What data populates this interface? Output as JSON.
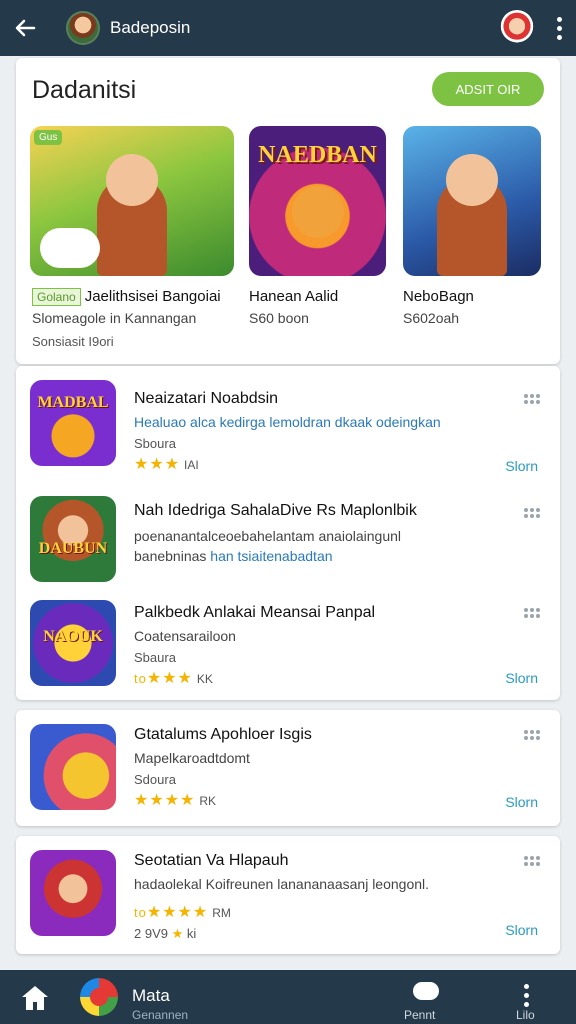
{
  "topbar": {
    "title": "Badeposin"
  },
  "featured": {
    "title": "Dadanitsi",
    "action_label": "ADSIT OIR",
    "items": [
      {
        "badge": "Golano",
        "tag": "Gus",
        "name": "Jaelithsisei Bangoiai",
        "sub": "Slomeagole in Kannangan",
        "extra": "Sonsiasit I9ori"
      },
      {
        "logo": "NAEDBAN",
        "name": "Hanean Aalid",
        "sub": "S60 boon"
      },
      {
        "name": "NeboBagn",
        "sub": "S602oah"
      }
    ]
  },
  "list": [
    {
      "icon_text": "MADBAL",
      "name": "Neaizatari Noabdsin",
      "desc": "Healuao alca kedirga lemoldran dkaak odeingkan",
      "meta": "Sboura",
      "stars": "★★★",
      "count": "IAI",
      "action": "Slorn"
    },
    {
      "icon_text": "DAUBUN",
      "name": "Nah Idedriga SahalaDive Rs Maplonlbik",
      "desc": "poenanantalceoebahelantam anaiolaingunl",
      "desc2_a": "banebninas",
      "desc2_b": "han tsiaitenabadtan",
      "action": ""
    },
    {
      "icon_text": "NAOUK",
      "name": "Palkbedk Anlakai Meansai Panpal",
      "desc": "Coatensarailoon",
      "meta": "Sbaura",
      "stars": "★★★",
      "star_prefix": "to",
      "count": "KK",
      "action": "Slorn"
    }
  ],
  "single_cards": [
    {
      "name": "Gtatalums Apohloer Isgis",
      "desc": "Mapelkaroadtdomt",
      "meta": "Sdoura",
      "stars": "★★★★",
      "count": "RK",
      "action": "Slorn"
    },
    {
      "name": "Seotatian Va Hlapauh",
      "desc": "hadaolekal Koifreunen lanananaasanj leongonl.",
      "stars": "★★★★",
      "star_prefix": "to",
      "count": "RM",
      "meta2": "2 9V9",
      "meta2_star": "★",
      "meta2_count": "ki",
      "action": "Slorn"
    }
  ],
  "bottombar": {
    "title": "Mata",
    "sub": "Genannen",
    "pen_label": "Pennt",
    "more_label": "Lilo"
  }
}
